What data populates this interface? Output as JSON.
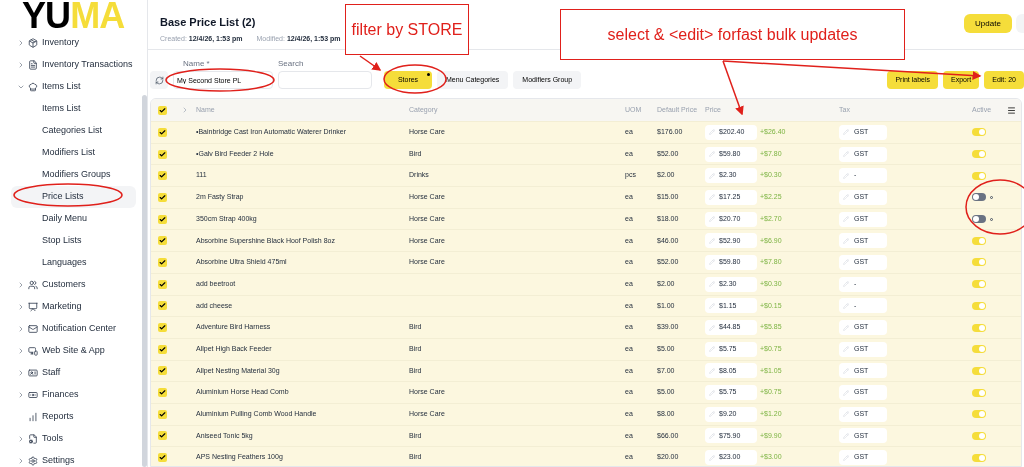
{
  "logo": {
    "dark": "YU",
    "accent": "MA"
  },
  "sidebar": {
    "items": [
      {
        "label": "Inventory",
        "kind": "group",
        "expanded": false,
        "selected": false
      },
      {
        "label": "Inventory Transactions",
        "kind": "group",
        "expanded": false,
        "selected": false
      },
      {
        "label": "Items List",
        "kind": "group",
        "expanded": true,
        "selected": false,
        "children": [
          {
            "label": "Items List",
            "selected": false
          },
          {
            "label": "Categories List",
            "selected": false
          },
          {
            "label": "Modifiers List",
            "selected": false
          },
          {
            "label": "Modifiers Groups",
            "selected": false
          },
          {
            "label": "Price Lists",
            "selected": true
          },
          {
            "label": "Daily Menu",
            "selected": false
          },
          {
            "label": "Stop Lists",
            "selected": false
          },
          {
            "label": "Languages",
            "selected": false
          }
        ]
      },
      {
        "label": "Customers",
        "kind": "group",
        "expanded": false,
        "selected": false
      },
      {
        "label": "Marketing",
        "kind": "group",
        "expanded": false,
        "selected": false
      },
      {
        "label": "Notification Center",
        "kind": "group",
        "expanded": false,
        "selected": false
      },
      {
        "label": "Web Site & App",
        "kind": "group",
        "expanded": false,
        "selected": false
      },
      {
        "label": "Staff",
        "kind": "group",
        "expanded": false,
        "selected": false
      },
      {
        "label": "Finances",
        "kind": "group",
        "expanded": false,
        "selected": false
      },
      {
        "label": "Reports",
        "kind": "link",
        "selected": false
      },
      {
        "label": "Tools",
        "kind": "group",
        "expanded": false,
        "selected": false
      },
      {
        "label": "Settings",
        "kind": "group",
        "expanded": false,
        "selected": false
      }
    ]
  },
  "header": {
    "title": "Base Price List (2)",
    "created_label": "Created:",
    "created": "12/4/26, 1:53 pm",
    "modified_label": "Modified:",
    "modified": "12/4/26, 1:53 pm",
    "update_button": "Update"
  },
  "toolbar": {
    "name_label": "Name *",
    "name_value": "My Second Store PL",
    "search_label": "Search",
    "filters": [
      {
        "label": "Stores",
        "selected": true,
        "badge": true
      },
      {
        "label": "Menu Categories",
        "selected": false,
        "badge": false
      },
      {
        "label": "Modifiers Group",
        "selected": false,
        "badge": false
      }
    ],
    "actions": [
      "Print labels",
      "Export",
      "Edit: 20"
    ]
  },
  "table": {
    "all_checked": true,
    "columns": [
      "Name",
      "Category",
      "UOM",
      "Default Price",
      "Price",
      "Tax",
      "Active"
    ],
    "rows": [
      {
        "checked": true,
        "name": "•Bainbridge Cast Iron Automatic Waterer Drinker",
        "category": "Horse Care",
        "uom": "ea",
        "default_price": "$176.00",
        "price": "$202.40",
        "diff": "+$26.40",
        "tax": "GST",
        "active": true
      },
      {
        "checked": true,
        "name": "•Galv Bird Feeder 2 Hole",
        "category": "Bird",
        "uom": "ea",
        "default_price": "$52.00",
        "price": "$59.80",
        "diff": "+$7.80",
        "tax": "GST",
        "active": true
      },
      {
        "checked": true,
        "name": "111",
        "category": "Drinks",
        "uom": "pcs",
        "default_price": "$2.00",
        "price": "$2.30",
        "diff": "+$0.30",
        "tax": "-",
        "active": true
      },
      {
        "checked": true,
        "name": "2m Fasty Strap",
        "category": "Horse Care",
        "uom": "ea",
        "default_price": "$15.00",
        "price": "$17.25",
        "diff": "+$2.25",
        "tax": "GST",
        "active": false
      },
      {
        "checked": true,
        "name": "350cm Strap 400kg",
        "category": "Horse Care",
        "uom": "ea",
        "default_price": "$18.00",
        "price": "$20.70",
        "diff": "+$2.70",
        "tax": "GST",
        "active": false
      },
      {
        "checked": true,
        "name": "Absorbine Supershine Black Hoof Polish 8oz",
        "category": "Horse Care",
        "uom": "ea",
        "default_price": "$46.00",
        "price": "$52.90",
        "diff": "+$6.90",
        "tax": "GST",
        "active": true
      },
      {
        "checked": true,
        "name": "Absorbine Ultra Shield 475ml",
        "category": "Horse Care",
        "uom": "ea",
        "default_price": "$52.00",
        "price": "$59.80",
        "diff": "+$7.80",
        "tax": "GST",
        "active": true
      },
      {
        "checked": true,
        "name": "add beetroot",
        "category": "",
        "uom": "ea",
        "default_price": "$2.00",
        "price": "$2.30",
        "diff": "+$0.30",
        "tax": "-",
        "active": true
      },
      {
        "checked": true,
        "name": "add cheese",
        "category": "",
        "uom": "ea",
        "default_price": "$1.00",
        "price": "$1.15",
        "diff": "+$0.15",
        "tax": "-",
        "active": true
      },
      {
        "checked": true,
        "name": "Adventure Bird Harness",
        "category": "Bird",
        "uom": "ea",
        "default_price": "$39.00",
        "price": "$44.85",
        "diff": "+$5.85",
        "tax": "GST",
        "active": true
      },
      {
        "checked": true,
        "name": "Allpet High Back Feeder",
        "category": "Bird",
        "uom": "ea",
        "default_price": "$5.00",
        "price": "$5.75",
        "diff": "+$0.75",
        "tax": "GST",
        "active": true
      },
      {
        "checked": true,
        "name": "Allpet Nesting Material 30g",
        "category": "Bird",
        "uom": "ea",
        "default_price": "$7.00",
        "price": "$8.05",
        "diff": "+$1.05",
        "tax": "GST",
        "active": true
      },
      {
        "checked": true,
        "name": "Aluminium Horse Head Comb",
        "category": "Horse Care",
        "uom": "ea",
        "default_price": "$5.00",
        "price": "$5.75",
        "diff": "+$0.75",
        "tax": "GST",
        "active": true
      },
      {
        "checked": true,
        "name": "Aluminium Pulling Comb Wood Handle",
        "category": "Horse Care",
        "uom": "ea",
        "default_price": "$8.00",
        "price": "$9.20",
        "diff": "+$1.20",
        "tax": "GST",
        "active": true
      },
      {
        "checked": true,
        "name": "Aniseed Tonic 5kg",
        "category": "Bird",
        "uom": "ea",
        "default_price": "$66.00",
        "price": "$75.90",
        "diff": "+$9.90",
        "tax": "GST",
        "active": true
      },
      {
        "checked": true,
        "name": "APS Nesting Feathers 100g",
        "category": "Bird",
        "uom": "ea",
        "default_price": "$20.00",
        "price": "$23.00",
        "diff": "+$3.00",
        "tax": "GST",
        "active": true
      }
    ]
  },
  "annotations": [
    "filter by STORE",
    "select & <edit> forfast bulk updates"
  ]
}
